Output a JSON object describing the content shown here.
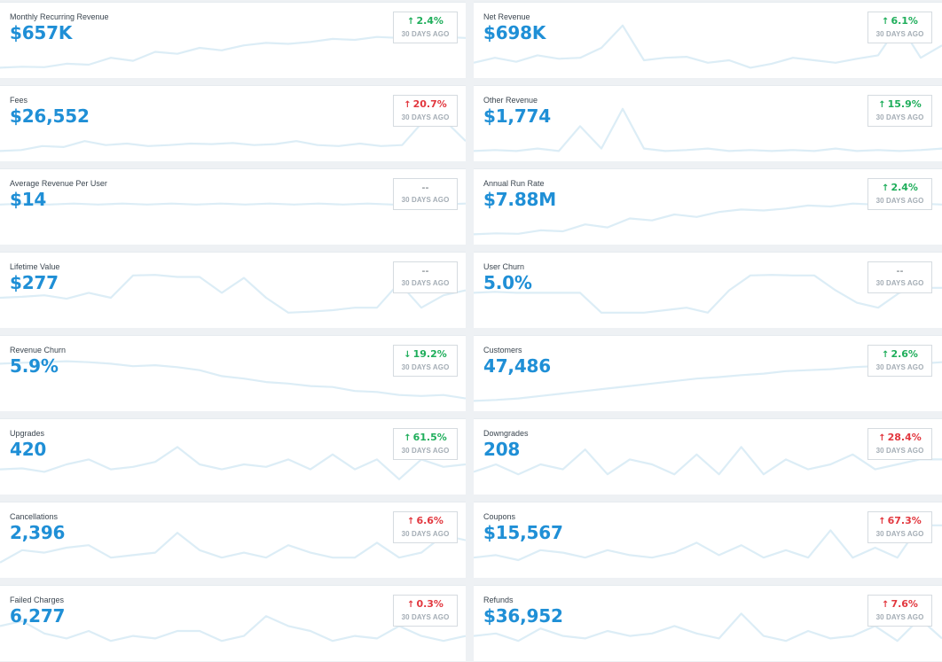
{
  "badge_sublabel": "30 DAYS AGO",
  "colors": {
    "value": "#1f8fd6",
    "positive": "#1fae5b",
    "negative": "#e2383f",
    "sparkline": "#dcedf6"
  },
  "metrics": [
    {
      "title": "Monthly Recurring Revenue",
      "value": "$657K",
      "change": "2.4%",
      "direction": "up",
      "tone": "good",
      "trend": [
        0.1,
        0.12,
        0.11,
        0.18,
        0.16,
        0.3,
        0.24,
        0.42,
        0.38,
        0.5,
        0.45,
        0.55,
        0.6,
        0.58,
        0.62,
        0.68,
        0.66,
        0.72,
        0.7,
        0.74,
        0.72,
        0.7
      ]
    },
    {
      "title": "Net Revenue",
      "value": "$698K",
      "change": "6.1%",
      "direction": "up",
      "tone": "good",
      "trend": [
        0.2,
        0.3,
        0.22,
        0.35,
        0.28,
        0.3,
        0.5,
        0.95,
        0.25,
        0.3,
        0.32,
        0.2,
        0.25,
        0.1,
        0.18,
        0.3,
        0.25,
        0.2,
        0.28,
        0.35,
        0.98,
        0.3,
        0.55
      ]
    },
    {
      "title": "Fees",
      "value": "$26,552",
      "change": "20.7%",
      "direction": "up",
      "tone": "bad",
      "trend": [
        0.1,
        0.12,
        0.2,
        0.18,
        0.3,
        0.22,
        0.25,
        0.2,
        0.22,
        0.25,
        0.24,
        0.26,
        0.22,
        0.24,
        0.3,
        0.22,
        0.2,
        0.25,
        0.2,
        0.22,
        0.7,
        0.72,
        0.3
      ]
    },
    {
      "title": "Other Revenue",
      "value": "$1,774",
      "change": "15.9%",
      "direction": "up",
      "tone": "good",
      "trend": [
        0.1,
        0.12,
        0.1,
        0.15,
        0.1,
        0.6,
        0.15,
        0.95,
        0.15,
        0.1,
        0.12,
        0.15,
        0.1,
        0.12,
        0.1,
        0.12,
        0.1,
        0.15,
        0.1,
        0.12,
        0.1,
        0.12,
        0.15
      ]
    },
    {
      "title": "Average Revenue Per User",
      "value": "$14",
      "change": "--",
      "direction": "none",
      "tone": "none",
      "trend": [
        0.7,
        0.72,
        0.7,
        0.72,
        0.7,
        0.72,
        0.7,
        0.72,
        0.7,
        0.72,
        0.7,
        0.72,
        0.7,
        0.72,
        0.7,
        0.72,
        0.7,
        0.72,
        0.7,
        0.72
      ]
    },
    {
      "title": "Annual Run Rate",
      "value": "$7.88M",
      "change": "2.4%",
      "direction": "up",
      "tone": "good",
      "trend": [
        0.1,
        0.12,
        0.11,
        0.18,
        0.16,
        0.3,
        0.24,
        0.42,
        0.38,
        0.5,
        0.45,
        0.55,
        0.6,
        0.58,
        0.62,
        0.68,
        0.66,
        0.72,
        0.7,
        0.74,
        0.72,
        0.7
      ]
    },
    {
      "title": "Lifetime Value",
      "value": "$277",
      "change": "--",
      "direction": "none",
      "tone": "none",
      "trend": [
        0.5,
        0.52,
        0.55,
        0.48,
        0.6,
        0.5,
        0.95,
        0.96,
        0.92,
        0.92,
        0.6,
        0.9,
        0.5,
        0.2,
        0.22,
        0.25,
        0.3,
        0.3,
        0.8,
        0.3,
        0.55,
        0.65
      ]
    },
    {
      "title": "User Churn",
      "value": "5.0%",
      "change": "--",
      "direction": "none",
      "tone": "none",
      "trend": [
        0.6,
        0.62,
        0.6,
        0.6,
        0.6,
        0.6,
        0.2,
        0.2,
        0.2,
        0.25,
        0.3,
        0.2,
        0.65,
        0.95,
        0.96,
        0.95,
        0.95,
        0.65,
        0.4,
        0.3,
        0.6,
        0.7,
        0.7
      ]
    },
    {
      "title": "Revenue Churn",
      "value": "5.9%",
      "change": "19.2%",
      "direction": "down",
      "tone": "good",
      "trend": [
        0.85,
        0.87,
        0.88,
        0.9,
        0.88,
        0.85,
        0.8,
        0.82,
        0.78,
        0.72,
        0.6,
        0.55,
        0.48,
        0.45,
        0.4,
        0.38,
        0.3,
        0.28,
        0.22,
        0.2,
        0.22,
        0.15
      ]
    },
    {
      "title": "Customers",
      "value": "47,486",
      "change": "2.6%",
      "direction": "up",
      "tone": "good",
      "trend": [
        0.1,
        0.12,
        0.15,
        0.2,
        0.25,
        0.3,
        0.35,
        0.4,
        0.45,
        0.5,
        0.55,
        0.58,
        0.62,
        0.65,
        0.7,
        0.72,
        0.74,
        0.78,
        0.8,
        0.82,
        0.85,
        0.88
      ]
    },
    {
      "title": "Upgrades",
      "value": "420",
      "change": "61.5%",
      "direction": "up",
      "tone": "good",
      "trend": [
        0.4,
        0.42,
        0.35,
        0.5,
        0.6,
        0.4,
        0.45,
        0.55,
        0.85,
        0.5,
        0.4,
        0.5,
        0.45,
        0.6,
        0.4,
        0.7,
        0.4,
        0.6,
        0.2,
        0.6,
        0.45,
        0.5
      ]
    },
    {
      "title": "Downgrades",
      "value": "208",
      "change": "28.4%",
      "direction": "up",
      "tone": "bad",
      "trend": [
        0.35,
        0.5,
        0.3,
        0.5,
        0.4,
        0.8,
        0.3,
        0.6,
        0.5,
        0.3,
        0.7,
        0.3,
        0.85,
        0.3,
        0.6,
        0.4,
        0.5,
        0.7,
        0.4,
        0.5,
        0.6,
        0.6
      ]
    },
    {
      "title": "Cancellations",
      "value": "2,396",
      "change": "6.6%",
      "direction": "up",
      "tone": "bad",
      "trend": [
        0.2,
        0.45,
        0.4,
        0.5,
        0.55,
        0.3,
        0.35,
        0.4,
        0.8,
        0.45,
        0.3,
        0.4,
        0.3,
        0.55,
        0.4,
        0.3,
        0.3,
        0.6,
        0.3,
        0.4,
        0.75,
        0.65
      ]
    },
    {
      "title": "Coupons",
      "value": "$15,567",
      "change": "67.3%",
      "direction": "up",
      "tone": "bad",
      "trend": [
        0.3,
        0.35,
        0.25,
        0.45,
        0.4,
        0.3,
        0.45,
        0.35,
        0.3,
        0.4,
        0.6,
        0.35,
        0.55,
        0.3,
        0.45,
        0.3,
        0.85,
        0.3,
        0.5,
        0.3,
        0.95,
        0.95
      ]
    },
    {
      "title": "Failed Charges",
      "value": "6,277",
      "change": "0.3%",
      "direction": "up",
      "tone": "bad",
      "trend": [
        0.6,
        0.7,
        0.45,
        0.35,
        0.5,
        0.3,
        0.4,
        0.35,
        0.5,
        0.5,
        0.3,
        0.4,
        0.8,
        0.6,
        0.5,
        0.3,
        0.4,
        0.35,
        0.6,
        0.4,
        0.3,
        0.4
      ]
    },
    {
      "title": "Refunds",
      "value": "$36,952",
      "change": "7.6%",
      "direction": "up",
      "tone": "bad",
      "trend": [
        0.4,
        0.45,
        0.3,
        0.55,
        0.4,
        0.35,
        0.5,
        0.4,
        0.45,
        0.6,
        0.45,
        0.35,
        0.85,
        0.4,
        0.3,
        0.5,
        0.35,
        0.4,
        0.6,
        0.3,
        0.75,
        0.35
      ]
    }
  ]
}
